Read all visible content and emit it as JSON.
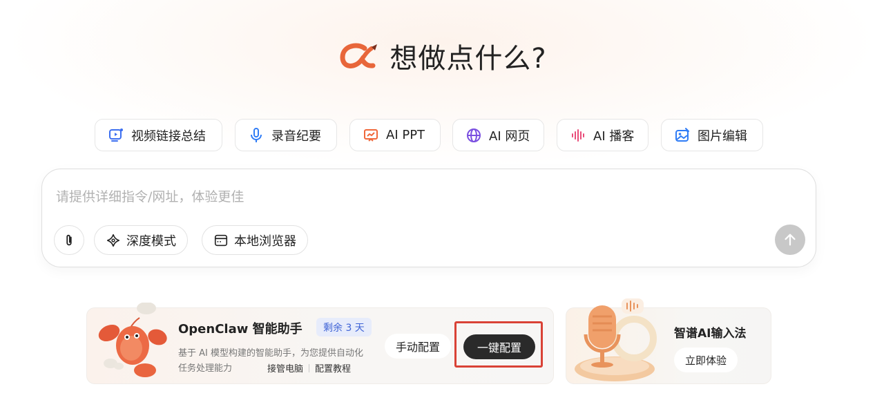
{
  "hero": {
    "title": "想做点什么?"
  },
  "chips": [
    {
      "label": "视频链接总结",
      "icon": "video-summary-icon"
    },
    {
      "label": "录音纪要",
      "icon": "microphone-icon"
    },
    {
      "label": "AI PPT",
      "icon": "presentation-icon"
    },
    {
      "label": "AI 网页",
      "icon": "globe-icon"
    },
    {
      "label": "AI 播客",
      "icon": "audio-wave-icon"
    },
    {
      "label": "图片编辑",
      "icon": "image-edit-icon"
    }
  ],
  "composer": {
    "placeholder": "请提供详细指令/网址，体验更佳",
    "deep_mode_label": "深度模式",
    "local_browser_label": "本地浏览器"
  },
  "openclaw": {
    "title": "OpenClaw 智能助手",
    "badge": "剩余 3 天",
    "description": "基于 AI 模型构建的智能助手，为您提供自动化任务处理能力",
    "link_takeover": "接管电脑",
    "link_tutorial": "配置教程",
    "manual_label": "手动配置",
    "oneclick_label": "一键配置"
  },
  "ime": {
    "title": "智谱AI输入法",
    "try_label": "立即体验"
  },
  "colors": {
    "brand": "#e8663a",
    "accent_blue": "#3f63d6",
    "highlight_red": "#d94236"
  }
}
